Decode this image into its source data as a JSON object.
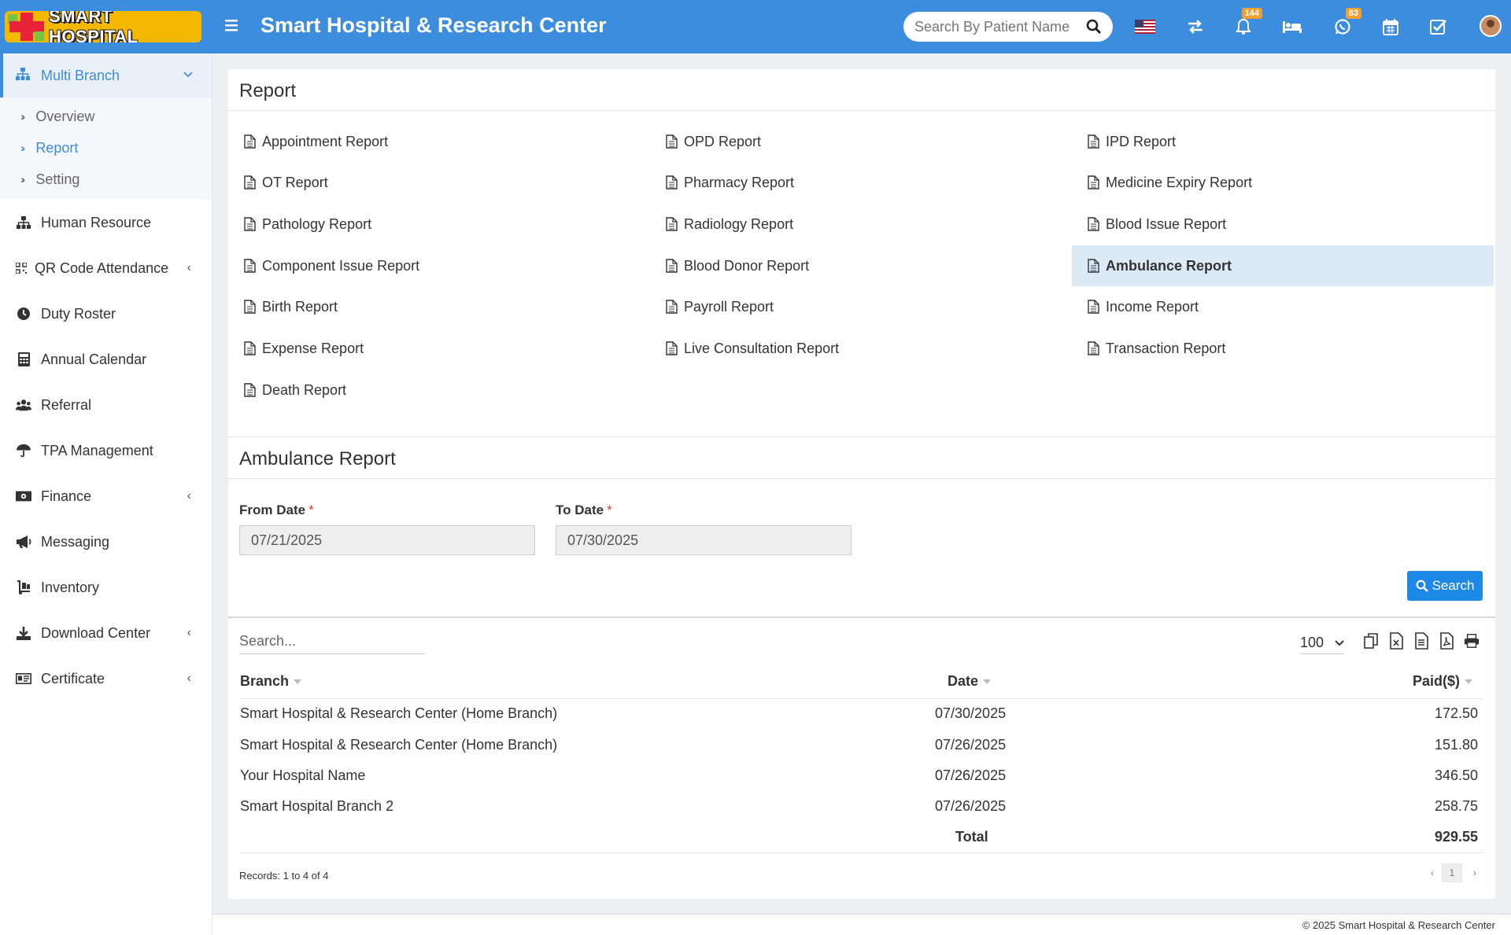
{
  "header": {
    "logo_text": "SMART HOSPITAL",
    "app_title": "Smart Hospital & Research Center",
    "search_placeholder": "Search By Patient Name",
    "notifications_count": "144",
    "whatsapp_count": "83"
  },
  "sidebar": {
    "active_item": "Multi Branch",
    "submenu": [
      "Overview",
      "Report",
      "Setting"
    ],
    "items": [
      "Human Resource",
      "QR Code Attendance",
      "Duty Roster",
      "Annual Calendar",
      "Referral",
      "TPA Management",
      "Finance",
      "Messaging",
      "Inventory",
      "Download Center",
      "Certificate"
    ]
  },
  "report_panel": {
    "title": "Report",
    "links": [
      "Appointment Report",
      "OPD Report",
      "IPD Report",
      "OT Report",
      "Pharmacy Report",
      "Medicine Expiry Report",
      "Pathology Report",
      "Radiology Report",
      "Blood Issue Report",
      "Component Issue Report",
      "Blood Donor Report",
      "Ambulance Report",
      "Birth Report",
      "Payroll Report",
      "Income Report",
      "Expense Report",
      "Live Consultation Report",
      "Transaction Report",
      "Death Report"
    ],
    "selected": "Ambulance Report"
  },
  "ambulance": {
    "title": "Ambulance Report",
    "from_label": "From Date",
    "from_value": "07/21/2025",
    "to_label": "To Date",
    "to_value": "07/30/2025",
    "required_mark": "*",
    "search_button": "Search"
  },
  "table": {
    "search_placeholder": "Search...",
    "page_size": "100",
    "columns": [
      "Branch",
      "Date",
      "Paid($)"
    ],
    "rows": [
      [
        "Smart Hospital & Research Center (Home Branch)",
        "07/30/2025",
        "172.50"
      ],
      [
        "Smart Hospital & Research Center (Home Branch)",
        "07/26/2025",
        "151.80"
      ],
      [
        "Your Hospital Name",
        "07/26/2025",
        "346.50"
      ],
      [
        "Smart Hospital Branch 2",
        "07/26/2025",
        "258.75"
      ]
    ],
    "total_label": "Total",
    "total_value": "929.55",
    "records_text": "Records: 1 to 4 of 4",
    "pager_prev": "‹",
    "pager_page": "1",
    "pager_next": "›"
  },
  "footer": {
    "text": "© 2025 Smart Hospital & Research Center"
  }
}
